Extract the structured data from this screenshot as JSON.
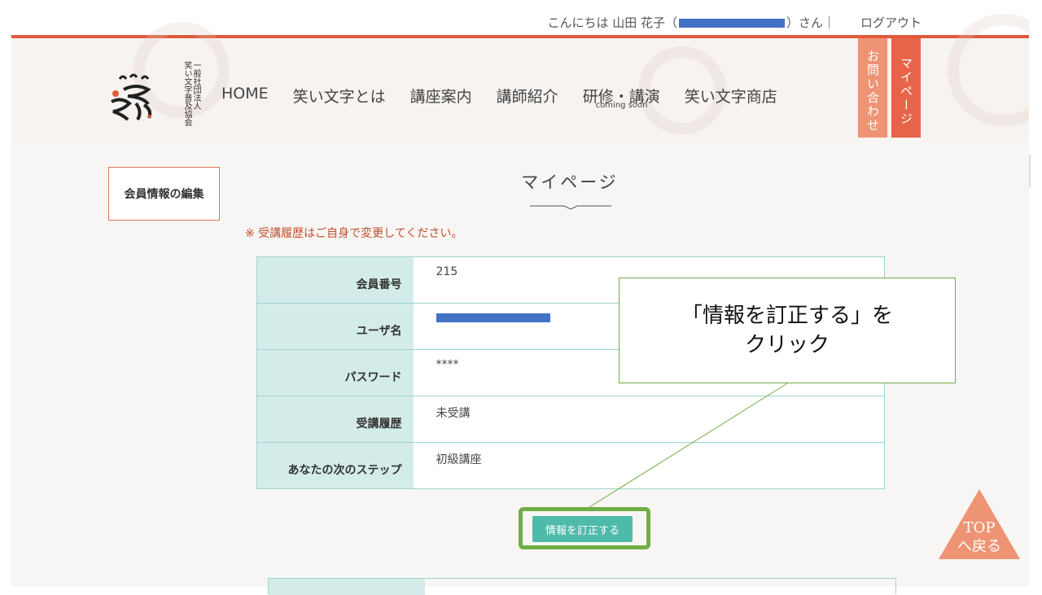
{
  "header": {
    "greeting_prefix": "こんにちは 山田 花子（",
    "greeting_suffix": "）さん｜",
    "logout": "ログアウト",
    "logo_text": [
      "一般",
      "社団法人",
      "笑い文字普及協会"
    ],
    "logo_text_lines": [
      "一般社団法人",
      "笑い文字普及協会"
    ],
    "contact_tab": "お問い合わせ",
    "mypage_tab": "マイページ",
    "nav": [
      {
        "label": "HOME"
      },
      {
        "label": "笑い文字とは"
      },
      {
        "label": "講座案内"
      },
      {
        "label": "講師紹介"
      },
      {
        "label": "研修・講演",
        "sub": "coming soon"
      },
      {
        "label": "笑い文字商店"
      }
    ]
  },
  "sidebar": {
    "edit_member": "会員情報の編集"
  },
  "main": {
    "title": "マイページ",
    "notice": "※ 受講履歴はご自身で変更してください。",
    "rows": [
      {
        "label": "会員番号",
        "value": "215"
      },
      {
        "label": "ユーザ名",
        "value": ""
      },
      {
        "label": "パスワード",
        "value": "****"
      },
      {
        "label": "受講履歴",
        "value": "未受講"
      },
      {
        "label": "あなたの次のステップ",
        "value": "初級講座"
      }
    ],
    "edit_button": "情報を訂正する"
  },
  "callout": {
    "line1": "「情報を訂正する」を",
    "line2": "クリック"
  },
  "top_button": {
    "line1": "TOP",
    "line2": "へ戻る"
  },
  "colors": {
    "accent_red": "#e05a3a",
    "teal": "#4ebaa9",
    "highlight_green": "#70ad47",
    "redaction_blue": "#4472c4"
  }
}
